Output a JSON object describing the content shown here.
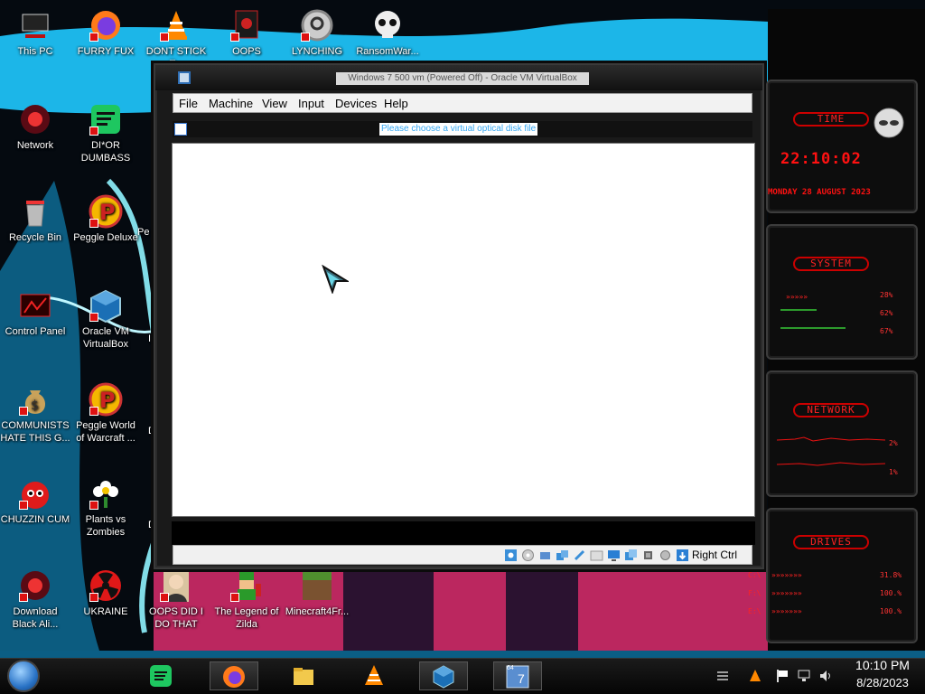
{
  "desktop": {
    "icons": [
      {
        "label": "This PC",
        "icon": "pc-icon"
      },
      {
        "label": "FURRY FUX",
        "icon": "firefox-icon"
      },
      {
        "label": "DONT STICK T...",
        "icon": "vlc-icon"
      },
      {
        "label": "OOPS",
        "icon": "red-cube-icon"
      },
      {
        "label": "LYNCHING",
        "icon": "gear-noose-icon"
      },
      {
        "label": "RansomWar...",
        "icon": "skull-icon"
      },
      {
        "label": "Network",
        "icon": "red-orb-icon"
      },
      {
        "label": "DI*OR DUMBASS",
        "icon": "green-chat-icon"
      },
      {
        "label": "Recycle Bin",
        "icon": "recycle-bin-icon"
      },
      {
        "label": "Peggle Deluxe",
        "icon": "peggle-icon"
      },
      {
        "label": "Control Panel",
        "icon": "control-panel-icon"
      },
      {
        "label": "Oracle VM VirtualBox",
        "icon": "virtualbox-icon"
      },
      {
        "label": "COMMUNISTS HATE THIS G...",
        "icon": "money-bag-icon"
      },
      {
        "label": "Peggle World of Warcraft ...",
        "icon": "peggle-icon"
      },
      {
        "label": "CHUZZIN CUM",
        "icon": "chuzzle-icon"
      },
      {
        "label": "Plants vs Zombies",
        "icon": "flower-icon"
      },
      {
        "label": "Download Black Ali...",
        "icon": "red-orb-icon"
      },
      {
        "label": "UKRAINE",
        "icon": "radiation-icon"
      },
      {
        "label": "OOPS DID I DO THAT",
        "icon": "portrait-icon"
      },
      {
        "label": "The Legend of Zilda",
        "icon": "pixel-hero-icon"
      },
      {
        "label": "Minecraft4Fr...",
        "icon": "grass-block-icon"
      }
    ],
    "partial_labels": [
      "Pe",
      "IS",
      "D",
      "D"
    ]
  },
  "vm_window": {
    "title": "Windows 7 500 vm (Powered Off) - Oracle VM VirtualBox",
    "menu": [
      "File",
      "Machine",
      "View",
      "Input",
      "Devices",
      "Help"
    ],
    "notice": "Please choose a virtual optical disk file",
    "host_key": "Right Ctrl"
  },
  "widgets": {
    "time": {
      "tag": "TIME",
      "clock": "22:10:02",
      "date": "MONDAY 28 AUGUST 2023"
    },
    "system": {
      "tag": "SYSTEM",
      "values": [
        "28%",
        "62%",
        "67%"
      ]
    },
    "network": {
      "tag": "NETWORK",
      "values": [
        "2%",
        "1%"
      ]
    },
    "drives": {
      "tag": "DRIVES",
      "values": [
        "31.8%",
        "100.%",
        "100.%"
      ],
      "letters": [
        "C:\\",
        "F:\\",
        "E:\\"
      ]
    }
  },
  "taskbar": {
    "apps": [
      "spotify-icon",
      "firefox-icon",
      "file-explorer-icon",
      "vlc-icon",
      "virtualbox-icon",
      "windows7-vm-icon"
    ],
    "vm_badge_top": "64",
    "vm_badge_num": "7",
    "time": "10:10 PM",
    "date": "8/28/2023"
  },
  "colors": {
    "accent_cyan": "#27d3ff",
    "widget_red": "#ff2222",
    "notice_blue": "#35a6f0"
  }
}
